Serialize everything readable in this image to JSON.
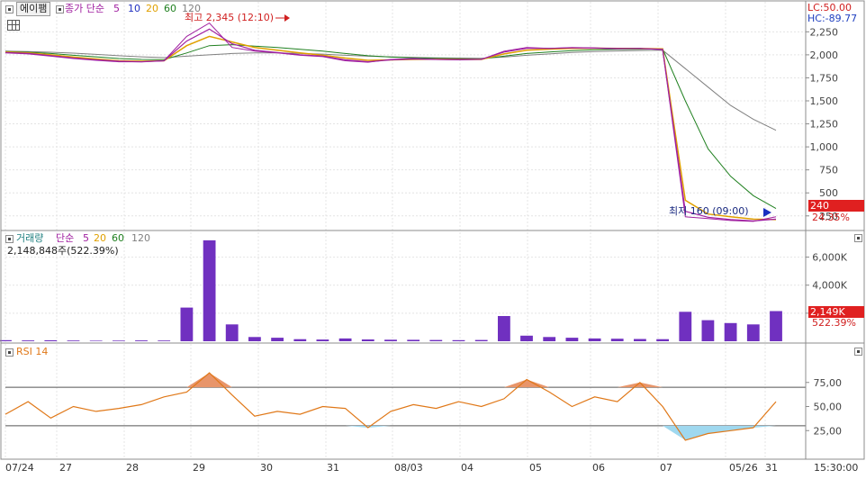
{
  "price_panel": {
    "box_label": "에이팸",
    "legend_prefix": "종가 단순",
    "ma_labels": [
      "5",
      "10",
      "20",
      "60",
      "120"
    ],
    "ma_colors": [
      "#a020a0",
      "#2030c0",
      "#e0a000",
      "#208020",
      "#808080"
    ],
    "lc_label": "LC:50.00",
    "hc_label": "HC:-89.77",
    "high_annotation": "최고 2,345 (12:10)",
    "low_annotation": "최저 160 (09:00)",
    "current_price": "240",
    "current_change": "24.35%"
  },
  "volume_panel": {
    "legend_prefix": "거래량",
    "ma_prefix": "단순",
    "ma_labels": [
      "5",
      "20",
      "60",
      "120"
    ],
    "ma_colors": [
      "#a020a0",
      "#e0a000",
      "#208020",
      "#808080"
    ],
    "value_text": "2,148,848주(522.39%)",
    "current_tag": "2,149K",
    "current_pct": "522.39%"
  },
  "rsi_panel": {
    "label": "RSI 14"
  },
  "x_axis_labels": [
    "07/24",
    "27",
    "28",
    "29",
    "30",
    "31",
    "08/03",
    "04",
    "05",
    "06",
    "07",
    "05/26",
    "31",
    "15:30:00"
  ],
  "colors": {
    "price_line": "#a020a0",
    "rsi_line": "#e07818",
    "rsi_fill_high": "#e8956a",
    "rsi_fill_low": "#9fd8ef",
    "volume_bar": "#7030c0",
    "red_tag": "#e02020",
    "lc_color": "#d02020",
    "hc_color": "#2040c0"
  },
  "chart_data": [
    {
      "type": "line",
      "title": "",
      "y_ticks": [
        "2,250",
        "2,000",
        "1,750",
        "1,500",
        "1,250",
        "1,000",
        "750",
        "500",
        "250"
      ],
      "ylim": [
        150,
        2400
      ],
      "series": [
        {
          "name": "종가",
          "values": [
            2020,
            2010,
            1985,
            1960,
            1940,
            1925,
            1925,
            1935,
            2200,
            2345,
            2080,
            2040,
            2020,
            1995,
            1980,
            1935,
            1920,
            1950,
            1960,
            1950,
            1945,
            1950,
            2040,
            2080,
            2070,
            2080,
            2075,
            2065,
            2070,
            2055,
            240,
            220,
            200,
            190,
            240
          ]
        },
        {
          "name": "5",
          "values": [
            2025,
            2015,
            1990,
            1965,
            1945,
            1930,
            1925,
            1935,
            2150,
            2280,
            2120,
            2050,
            2025,
            2000,
            1985,
            1945,
            1925,
            1945,
            1955,
            1950,
            1948,
            1952,
            2030,
            2070,
            2070,
            2075,
            2073,
            2068,
            2068,
            2060,
            300,
            235,
            210,
            195,
            215
          ]
        },
        {
          "name": "20",
          "values": [
            2030,
            2020,
            2000,
            1975,
            1955,
            1935,
            1930,
            1935,
            2100,
            2200,
            2140,
            2080,
            2050,
            2020,
            1995,
            1965,
            1940,
            1945,
            1950,
            1952,
            1950,
            1950,
            2010,
            2050,
            2062,
            2070,
            2072,
            2070,
            2068,
            2064,
            420,
            270,
            240,
            215,
            210
          ]
        },
        {
          "name": "60",
          "values": [
            2035,
            2028,
            2015,
            1995,
            1978,
            1960,
            1950,
            1948,
            2020,
            2100,
            2110,
            2095,
            2080,
            2060,
            2040,
            2015,
            1990,
            1975,
            1968,
            1962,
            1958,
            1955,
            1985,
            2015,
            2030,
            2045,
            2055,
            2060,
            2062,
            2063,
            1500,
            980,
            680,
            470,
            330
          ]
        },
        {
          "name": "120",
          "values": [
            2040,
            2035,
            2028,
            2018,
            2005,
            1990,
            1978,
            1970,
            1985,
            2000,
            2015,
            2020,
            2020,
            2015,
            2008,
            1995,
            1985,
            1978,
            1972,
            1968,
            1965,
            1963,
            1975,
            1995,
            2010,
            2025,
            2035,
            2042,
            2047,
            2050,
            1850,
            1650,
            1450,
            1300,
            1180
          ]
        }
      ]
    },
    {
      "type": "bar",
      "title": "",
      "y_ticks": [
        "6,000K",
        "4,000K",
        "2,000K"
      ],
      "ylim": [
        0,
        7000
      ],
      "values": [
        80,
        60,
        70,
        50,
        40,
        45,
        60,
        50,
        2400,
        7200,
        1200,
        300,
        250,
        150,
        120,
        200,
        130,
        110,
        100,
        90,
        80,
        90,
        1800,
        400,
        300,
        250,
        200,
        180,
        160,
        150,
        2100,
        1500,
        1300,
        1200,
        2149
      ]
    },
    {
      "type": "line",
      "title": "",
      "y_ticks": [
        "75,00",
        "50,00",
        "25,00"
      ],
      "ylim": [
        0,
        100
      ],
      "reference_lines": [
        70,
        30
      ],
      "series": [
        {
          "name": "RSI 14",
          "values": [
            42,
            55,
            38,
            50,
            45,
            48,
            52,
            60,
            65,
            85,
            62,
            40,
            45,
            42,
            50,
            48,
            28,
            45,
            52,
            48,
            55,
            50,
            58,
            78,
            65,
            50,
            60,
            55,
            75,
            50,
            15,
            22,
            25,
            28,
            55
          ]
        }
      ]
    }
  ]
}
